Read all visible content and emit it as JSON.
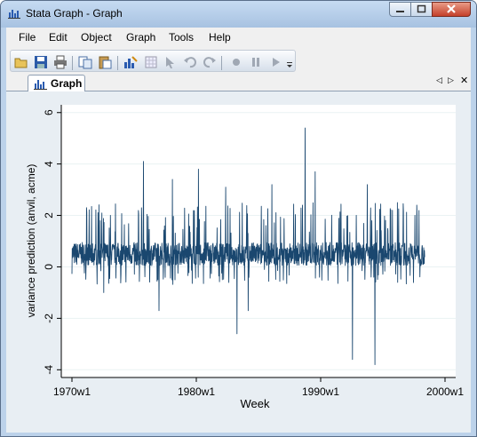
{
  "window": {
    "title": "Stata Graph - Graph"
  },
  "menu": [
    "File",
    "Edit",
    "Object",
    "Graph",
    "Tools",
    "Help"
  ],
  "toolbar": {
    "icons": [
      "open-icon",
      "save-icon",
      "print-icon",
      "copy-icon",
      "paste-icon",
      "graph-editor-icon",
      "grid-icon",
      "pointer-icon",
      "undo-icon",
      "redo-icon",
      "record-icon",
      "pause-icon",
      "play-icon"
    ]
  },
  "tab": {
    "label": "Graph"
  },
  "chart_data": {
    "type": "line",
    "xlabel": "Week",
    "ylabel": "variance prediction (anvil, acme)",
    "x_tick_labels": [
      "1970w1",
      "1980w1",
      "1990w1",
      "2000w1"
    ],
    "y_tick_labels": [
      "-4",
      "-2",
      "0",
      "2",
      "4",
      "6"
    ],
    "ylim": [
      -4.3,
      6.3
    ],
    "x_range": [
      "1970w1",
      "2000w1"
    ],
    "grid": true,
    "series": [
      {
        "color": "#1a476f",
        "x_start": "1970w1",
        "x_end": "1998w20",
        "baseline": 0.5,
        "spikes": [
          {
            "x": "1971w10",
            "y": 2.3
          },
          {
            "x": "1972w30",
            "y": -1.0
          },
          {
            "x": "1975w40",
            "y": 4.1
          },
          {
            "x": "1977w1",
            "y": -1.7
          },
          {
            "x": "1978w5",
            "y": 3.4
          },
          {
            "x": "1980w10",
            "y": 3.8
          },
          {
            "x": "1982w20",
            "y": 3.1
          },
          {
            "x": "1983w15",
            "y": -2.6
          },
          {
            "x": "1984w10",
            "y": -1.7
          },
          {
            "x": "1986w5",
            "y": 3.2
          },
          {
            "x": "1988w40",
            "y": 5.4
          },
          {
            "x": "1989w30",
            "y": 3.7
          },
          {
            "x": "1992w30",
            "y": -3.6
          },
          {
            "x": "1993w40",
            "y": 3.2
          },
          {
            "x": "1994w20",
            "y": -3.8
          },
          {
            "x": "1996w10",
            "y": 2.5
          },
          {
            "x": "1997w40",
            "y": 2.0
          }
        ]
      }
    ]
  },
  "colors": {
    "plot_background": "#ffffff",
    "graph_background": "#e8eef3",
    "line": "#1a476f"
  }
}
